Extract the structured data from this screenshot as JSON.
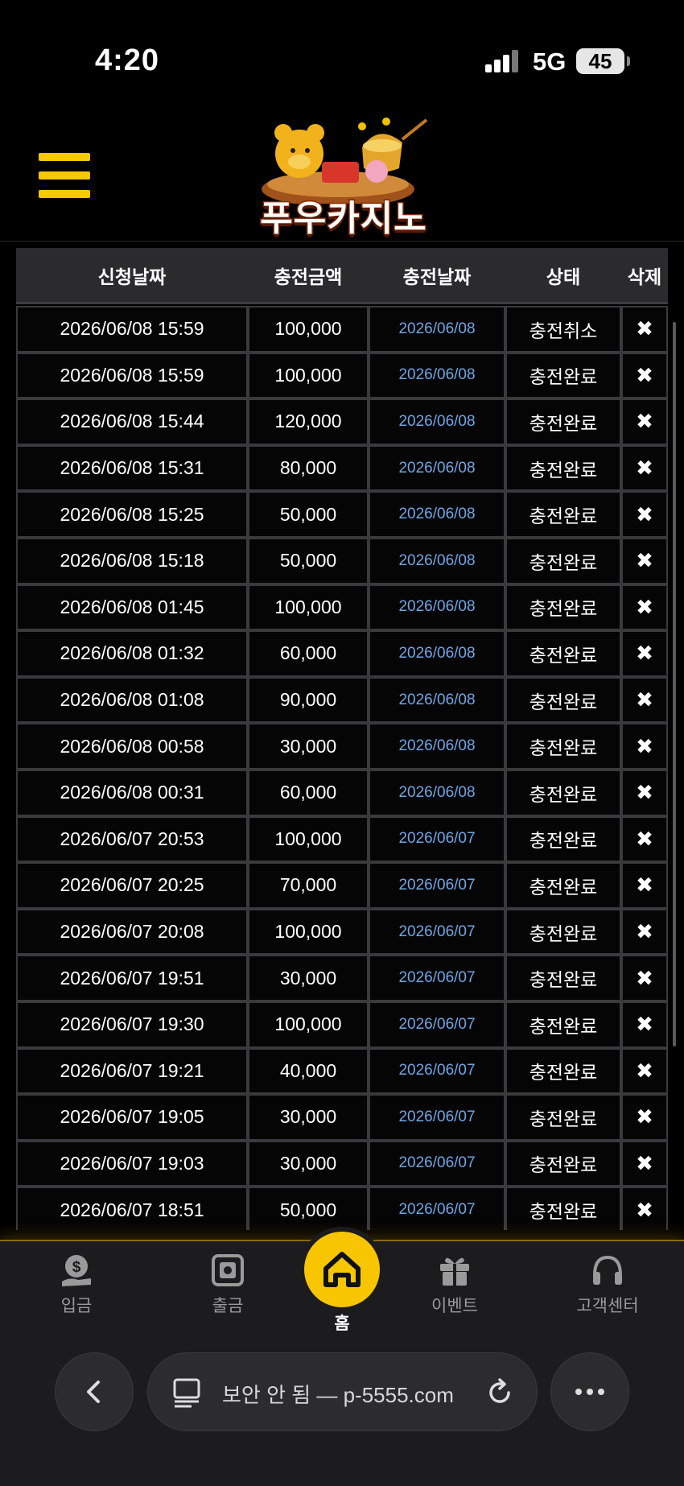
{
  "status_bar": {
    "time": "4:20",
    "network": "5G",
    "battery": "45"
  },
  "header": {
    "logo_text": "푸우카지노"
  },
  "table": {
    "headers": [
      "신청날짜",
      "충전금액",
      "충전날짜",
      "상태",
      "삭제"
    ],
    "delete_symbol": "✖",
    "rows": [
      [
        "2026/06/08 15:59",
        "100,000",
        "2026/06/08",
        "충전취소"
      ],
      [
        "2026/06/08 15:59",
        "100,000",
        "2026/06/08",
        "충전완료"
      ],
      [
        "2026/06/08 15:44",
        "120,000",
        "2026/06/08",
        "충전완료"
      ],
      [
        "2026/06/08 15:31",
        "80,000",
        "2026/06/08",
        "충전완료"
      ],
      [
        "2026/06/08 15:25",
        "50,000",
        "2026/06/08",
        "충전완료"
      ],
      [
        "2026/06/08 15:18",
        "50,000",
        "2026/06/08",
        "충전완료"
      ],
      [
        "2026/06/08 01:45",
        "100,000",
        "2026/06/08",
        "충전완료"
      ],
      [
        "2026/06/08 01:32",
        "60,000",
        "2026/06/08",
        "충전완료"
      ],
      [
        "2026/06/08 01:08",
        "90,000",
        "2026/06/08",
        "충전완료"
      ],
      [
        "2026/06/08 00:58",
        "30,000",
        "2026/06/08",
        "충전완료"
      ],
      [
        "2026/06/08 00:31",
        "60,000",
        "2026/06/08",
        "충전완료"
      ],
      [
        "2026/06/07 20:53",
        "100,000",
        "2026/06/07",
        "충전완료"
      ],
      [
        "2026/06/07 20:25",
        "70,000",
        "2026/06/07",
        "충전완료"
      ],
      [
        "2026/06/07 20:08",
        "100,000",
        "2026/06/07",
        "충전완료"
      ],
      [
        "2026/06/07 19:51",
        "30,000",
        "2026/06/07",
        "충전완료"
      ],
      [
        "2026/06/07 19:30",
        "100,000",
        "2026/06/07",
        "충전완료"
      ],
      [
        "2026/06/07 19:21",
        "40,000",
        "2026/06/07",
        "충전완료"
      ],
      [
        "2026/06/07 19:05",
        "30,000",
        "2026/06/07",
        "충전완료"
      ],
      [
        "2026/06/07 19:03",
        "30,000",
        "2026/06/07",
        "충전완료"
      ],
      [
        "2026/06/07 18:51",
        "50,000",
        "2026/06/07",
        "충전완료"
      ]
    ]
  },
  "bottom_nav": {
    "deposit": "입금",
    "withdraw": "출금",
    "home": "홈",
    "event": "이벤트",
    "support": "고객센터"
  },
  "browser": {
    "url_text": "보안 안 됨 — p-5555.com"
  },
  "colors": {
    "accent": "#f7c600",
    "link_date": "#6fa6e6",
    "background": "#000000"
  }
}
